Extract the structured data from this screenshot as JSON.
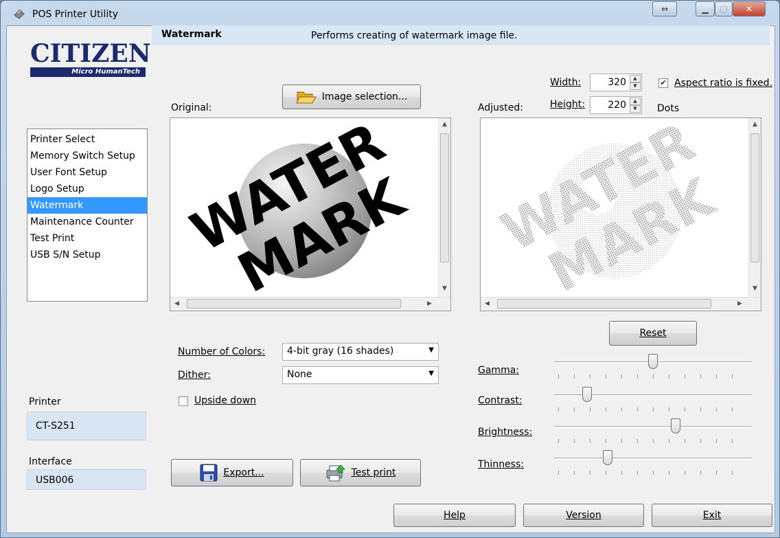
{
  "window": {
    "title": "POS Printer Utility"
  },
  "logo": {
    "name": "CITIZEN",
    "sub": "Micro HumanTech"
  },
  "nav": {
    "items": [
      {
        "label": "Printer Select"
      },
      {
        "label": "Memory Switch Setup"
      },
      {
        "label": "User Font Setup"
      },
      {
        "label": "Logo Setup"
      },
      {
        "label": "Watermark"
      },
      {
        "label": "Maintenance Counter"
      },
      {
        "label": "Test Print"
      },
      {
        "label": "USB S/N Setup"
      }
    ],
    "selected": "Watermark"
  },
  "sidebar": {
    "printer_label": "Printer",
    "printer_value": "CT-S251",
    "interface_label": "Interface",
    "interface_value": "USB006"
  },
  "header": {
    "title": "Watermark",
    "description": "Performs creating of watermark image file."
  },
  "image_panel": {
    "select_button": "Image selection...",
    "original_label": "Original:",
    "adjusted_label": "Adjusted:",
    "watermark_line1": "WATER",
    "watermark_line2": "MARK"
  },
  "size": {
    "width_label": "Width:",
    "width_value": "320",
    "height_label": "Height:",
    "height_value": "220",
    "aspect_label": "Aspect ratio is fixed.",
    "aspect_checked": true,
    "units": "Dots"
  },
  "options": {
    "colors_label": "Number of Colors:",
    "colors_value": "4-bit gray (16 shades)",
    "dither_label": "Dither:",
    "dither_value": "None",
    "upside_down_label": "Upside down",
    "upside_down_checked": false
  },
  "adjust": {
    "reset_button": "Reset",
    "sliders": [
      {
        "label": "Gamma:",
        "value": 0.5
      },
      {
        "label": "Contrast:",
        "value": 0.15
      },
      {
        "label": "Brightness:",
        "value": 0.62
      },
      {
        "label": "Thinness:",
        "value": 0.26
      }
    ]
  },
  "actions": {
    "export": "Export...",
    "test_print": "Test print",
    "help": "Help",
    "version": "Version",
    "exit": "Exit"
  }
}
